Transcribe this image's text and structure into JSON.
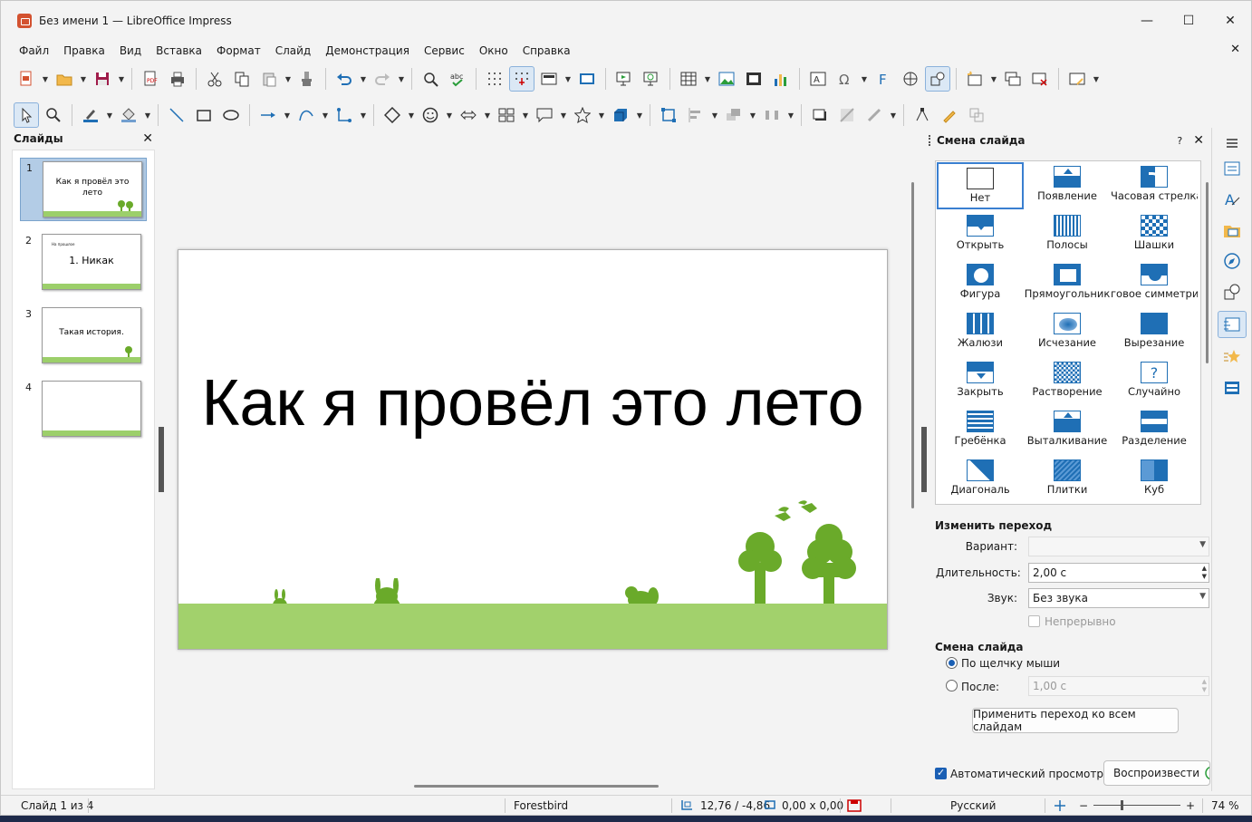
{
  "window": {
    "title": "Без имени 1 — LibreOffice Impress",
    "minimize": "—",
    "maximize": "☐",
    "close": "✕"
  },
  "menu": {
    "items": [
      "Файл",
      "Правка",
      "Вид",
      "Вставка",
      "Формат",
      "Слайд",
      "Демонстрация",
      "Сервис",
      "Окно",
      "Справка"
    ],
    "close_doc": "✕"
  },
  "slides_pane": {
    "title": "Слайды",
    "close": "✕",
    "slides": [
      {
        "num": "1",
        "title": "Как я провёл это лето",
        "selected": true
      },
      {
        "num": "2",
        "title": "1. Никак",
        "subtitle": "На прошлое",
        "selected": false
      },
      {
        "num": "3",
        "title": "Такая история.",
        "selected": false
      },
      {
        "num": "4",
        "title": "",
        "selected": false
      }
    ]
  },
  "slide": {
    "title": "Как я провёл это лето"
  },
  "sidebar": {
    "title": "Смена слайда",
    "help": "?",
    "close": "✕",
    "transitions": [
      {
        "label": "Нет",
        "icon": "none-icon",
        "selected": true
      },
      {
        "label": "Появление",
        "icon": "wipe-icon"
      },
      {
        "label": "Часовая стрелка",
        "icon": "clockwise-icon"
      },
      {
        "label": "Открыть",
        "icon": "uncover-icon"
      },
      {
        "label": "Полосы",
        "icon": "bars-icon"
      },
      {
        "label": "Шашки",
        "icon": "checkers-icon"
      },
      {
        "label": "Фигура",
        "icon": "shape-icon"
      },
      {
        "label": "Прямоугольник",
        "icon": "box-icon"
      },
      {
        "label": "говое симметрич",
        "icon": "wedge-icon"
      },
      {
        "label": "Жалюзи",
        "icon": "venetian-icon"
      },
      {
        "label": "Исчезание",
        "icon": "fade-icon"
      },
      {
        "label": "Вырезание",
        "icon": "cut-icon"
      },
      {
        "label": "Закрыть",
        "icon": "cover-icon"
      },
      {
        "label": "Растворение",
        "icon": "dissolve-icon"
      },
      {
        "label": "Случайно",
        "icon": "random-icon"
      },
      {
        "label": "Гребёнка",
        "icon": "comb-icon"
      },
      {
        "label": "Выталкивание",
        "icon": "push-icon"
      },
      {
        "label": "Разделение",
        "icon": "split-icon"
      },
      {
        "label": "Диагональ",
        "icon": "diagonal-icon"
      },
      {
        "label": "Плитки",
        "icon": "tiles-icon"
      },
      {
        "label": "Куб",
        "icon": "cube-icon"
      }
    ],
    "modify": {
      "heading": "Изменить переход",
      "variant_label": "Вариант:",
      "variant_value": "",
      "duration_label": "Длительность:",
      "duration_value": "2,00 с",
      "sound_label": "Звук:",
      "sound_value": "Без звука",
      "loop_label": "Непрерывно"
    },
    "advance": {
      "heading": "Смена слайда",
      "on_click_label": "По щелчку мыши",
      "after_label": "После:",
      "after_value": "1,00 с",
      "apply_all": "Применить переход ко всем слайдам"
    },
    "preview": {
      "auto_label": "Автоматический просмотр",
      "auto_checked": true,
      "play_label": "Воспроизвести"
    }
  },
  "statusbar": {
    "slide_info": "Слайд 1 из 4",
    "master": "Forestbird",
    "position": "12,76 / -4,86",
    "size": "0,00 x 0,00",
    "language": "Русский",
    "zoom": "74 %"
  },
  "colors": {
    "accent": "#1a5fb4",
    "grass": "#a2d16c",
    "tree": "#6aaa2a",
    "icon_blue": "#1f6fb5"
  }
}
